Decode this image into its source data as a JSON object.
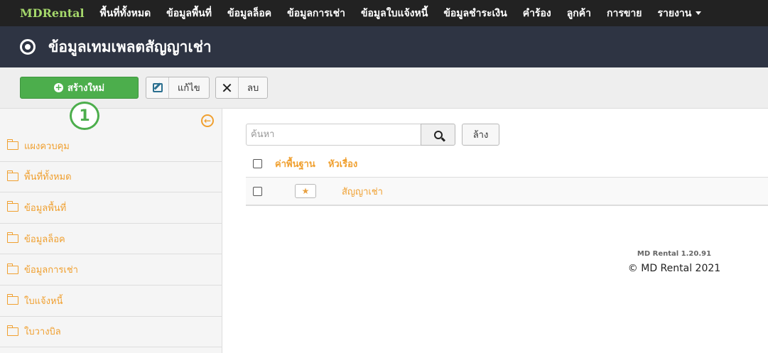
{
  "nav": {
    "brand": "MDRental",
    "items": [
      "พื้นที่ทั้งหมด",
      "ข้อมูลพื้นที่",
      "ข้อมูลล็อค",
      "ข้อมูลการเช่า",
      "ข้อมูลใบแจ้งหนี้",
      "ข้อมูลชำระเงิน",
      "คำร้อง",
      "ลูกค้า",
      "การขาย",
      "รายงาน"
    ]
  },
  "header": {
    "title": "ข้อมูลเทมเพลตสัญญาเช่า"
  },
  "toolbar": {
    "create_label": "สร้างใหม่",
    "edit_label": "แก้ไข",
    "delete_label": "ลบ"
  },
  "callout": "1",
  "sidebar": {
    "items": [
      "แผงควบคุม",
      "พื้นที่ทั้งหมด",
      "ข้อมูลพื้นที่",
      "ข้อมูลล็อค",
      "ข้อมูลการเช่า",
      "ใบแจ้งหนี้",
      "ใบวางบิล"
    ]
  },
  "search": {
    "placeholder": "ค้นหา",
    "clear_label": "ล้าง"
  },
  "table": {
    "columns": [
      "ค่าพื้นฐาน",
      "หัวเรื่อง"
    ],
    "rows": [
      {
        "default": true,
        "title": "สัญญาเช่า"
      }
    ]
  },
  "footer": {
    "version": "MD Rental 1.20.91",
    "copyright": "© MD Rental 2021"
  }
}
